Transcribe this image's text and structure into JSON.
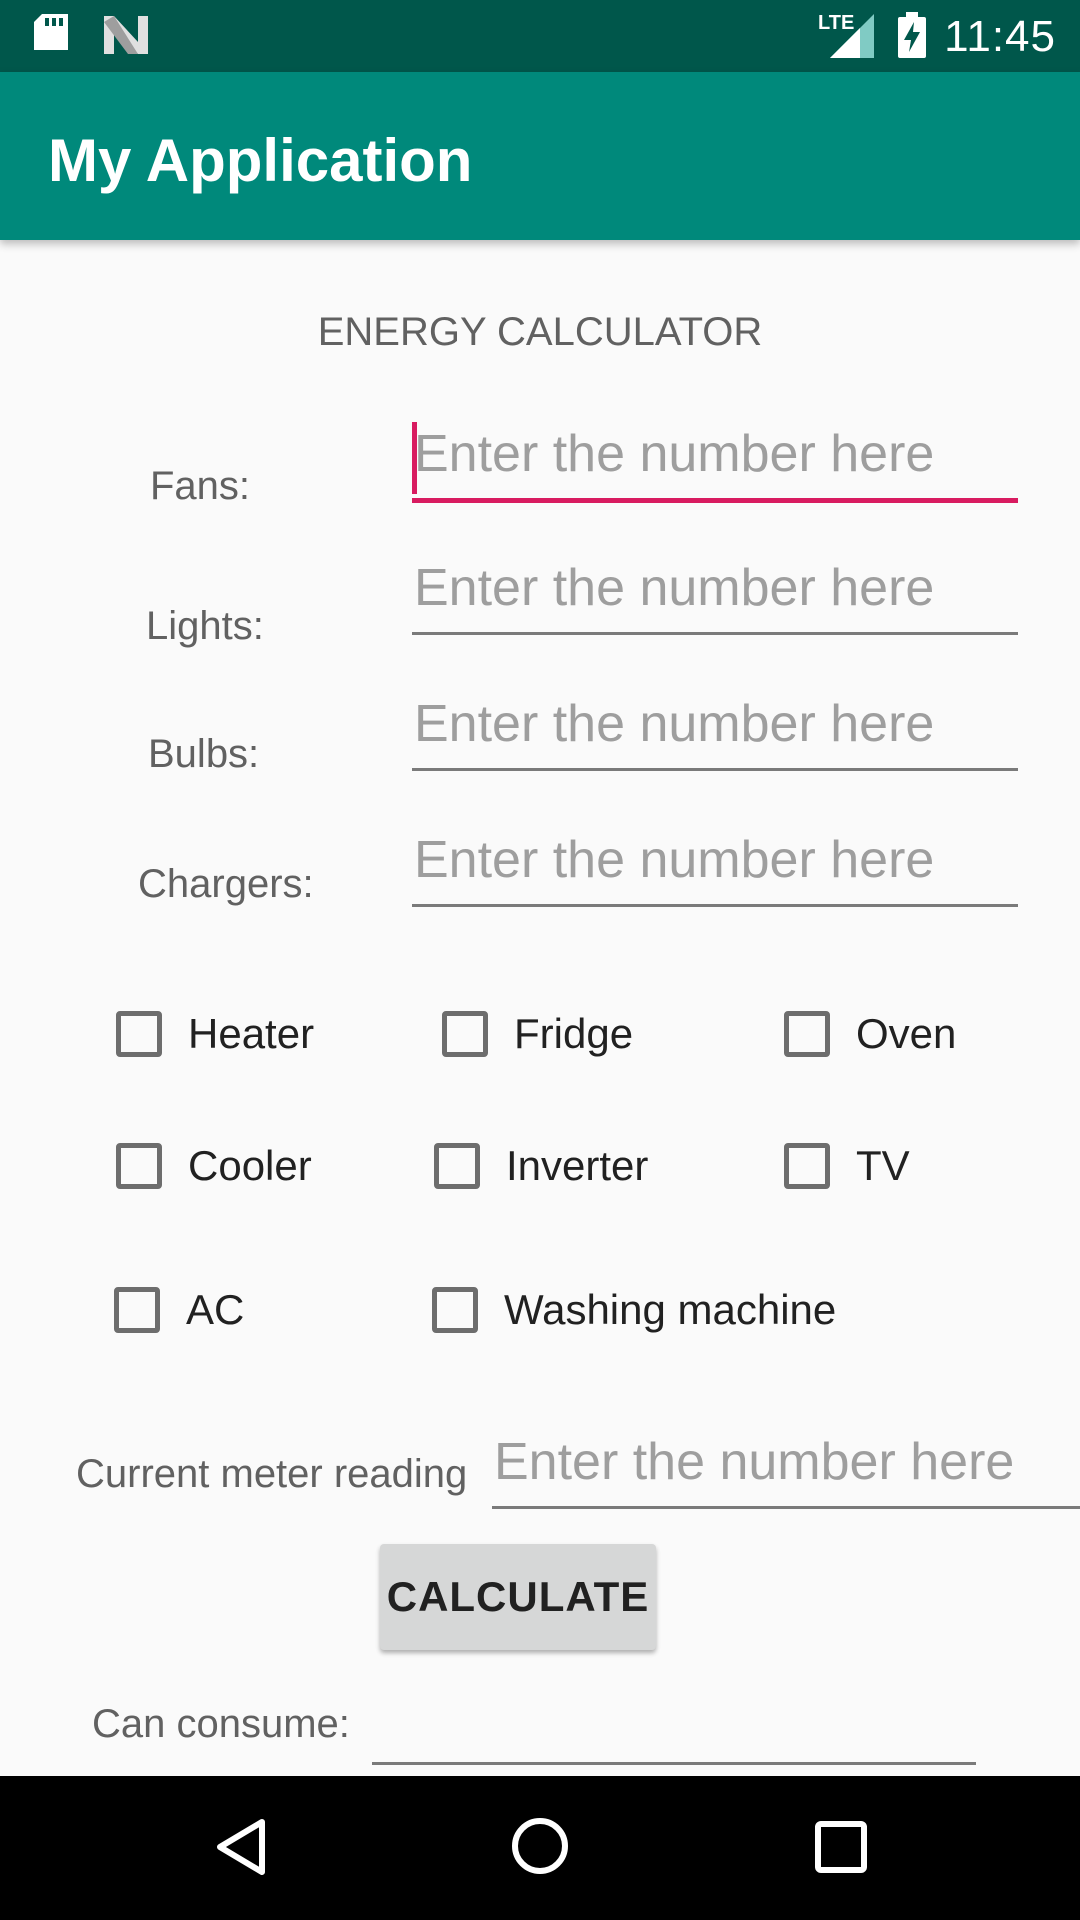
{
  "status_bar": {
    "time": "11:45",
    "network_label": "LTE",
    "icons": [
      "sd-card-icon",
      "n-logo-icon",
      "lte-signal-icon",
      "battery-charging-icon"
    ]
  },
  "app_bar": {
    "title": "My Application"
  },
  "main": {
    "heading": "ENERGY CALCULATOR",
    "inputs": [
      {
        "label": "Fans:",
        "value": "",
        "placeholder": "Enter the number here"
      },
      {
        "label": "Lights:",
        "value": "",
        "placeholder": "Enter the number here"
      },
      {
        "label": "Bulbs:",
        "value": "",
        "placeholder": "Enter the number here"
      },
      {
        "label": "Chargers:",
        "value": "",
        "placeholder": "Enter the number here"
      }
    ],
    "checkboxes": [
      {
        "label": "Heater",
        "checked": false
      },
      {
        "label": "Fridge",
        "checked": false
      },
      {
        "label": "Oven",
        "checked": false
      },
      {
        "label": "Cooler",
        "checked": false
      },
      {
        "label": "Inverter",
        "checked": false
      },
      {
        "label": "TV",
        "checked": false
      },
      {
        "label": "AC",
        "checked": false
      },
      {
        "label": "Washing machine",
        "checked": false
      }
    ],
    "meter": {
      "label": "Current meter reading",
      "value": "",
      "placeholder": "Enter the number here"
    },
    "calculate_label": "CALCULATE",
    "result": {
      "label": "Can consume:",
      "value": ""
    }
  },
  "nav_bar": {
    "icons": [
      "back-icon",
      "home-icon",
      "recents-icon"
    ]
  },
  "colors": {
    "status_bar": "#00574b",
    "app_bar": "#00897b",
    "accent": "#d81b60",
    "background": "#fafafa"
  }
}
